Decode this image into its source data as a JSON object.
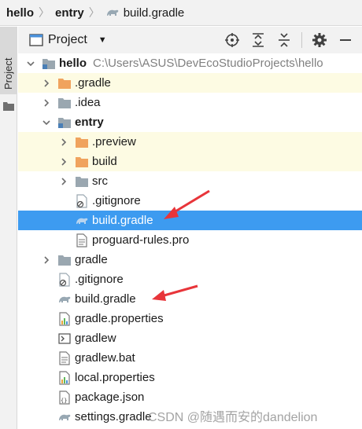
{
  "breadcrumb": {
    "items": [
      "hello",
      "entry"
    ],
    "file": "build.gradle"
  },
  "stripe": {
    "label": "Project"
  },
  "header": {
    "title": "Project"
  },
  "tree": {
    "root_path": "C:\\Users\\ASUS\\DevEcoStudioProjects\\hello",
    "rows": [
      {
        "label": "hello"
      },
      {
        "label": ".gradle"
      },
      {
        "label": ".idea"
      },
      {
        "label": "entry"
      },
      {
        "label": ".preview"
      },
      {
        "label": "build"
      },
      {
        "label": "src"
      },
      {
        "label": ".gitignore"
      },
      {
        "label": "build.gradle"
      },
      {
        "label": "proguard-rules.pro"
      },
      {
        "label": "gradle"
      },
      {
        "label": ".gitignore"
      },
      {
        "label": "build.gradle"
      },
      {
        "label": "gradle.properties"
      },
      {
        "label": "gradlew"
      },
      {
        "label": "gradlew.bat"
      },
      {
        "label": "local.properties"
      },
      {
        "label": "package.json"
      },
      {
        "label": "settings.gradle"
      }
    ]
  },
  "watermark": "CSDN @随遇而安的dandelion",
  "colors": {
    "selection": "#3d9bf0",
    "excluded_highlight": "#fdfbe3",
    "annotation_arrow": "#e8353a",
    "orange_folder": "#f0a35e",
    "gray_folder": "#9aa7b0"
  }
}
